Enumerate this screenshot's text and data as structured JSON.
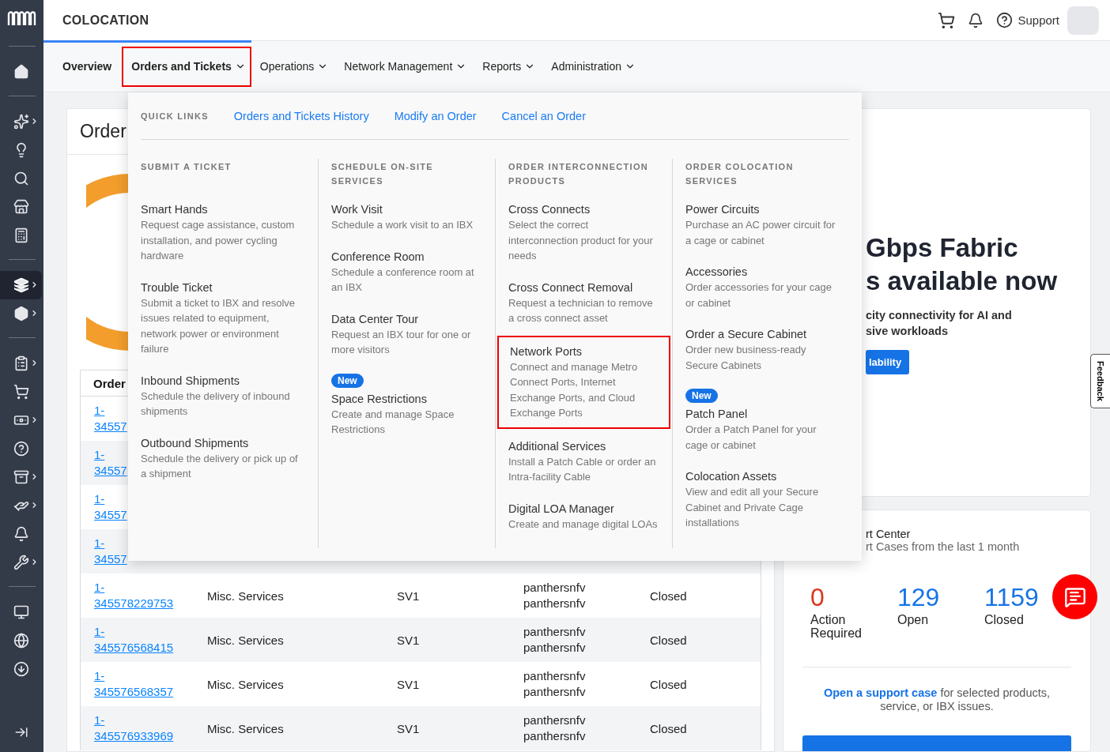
{
  "header": {
    "title": "COLOCATION",
    "support_label": "Support"
  },
  "sidebar": {
    "groups": [
      [
        {
          "expandable": false,
          "selected": false
        }
      ],
      [
        {
          "expandable": true,
          "selected": false
        },
        {
          "expandable": false,
          "selected": false
        },
        {
          "expandable": false,
          "selected": false
        },
        {
          "expandable": false,
          "selected": false
        },
        {
          "expandable": false,
          "selected": false
        }
      ],
      [
        {
          "expandable": true,
          "selected": true
        },
        {
          "expandable": true,
          "selected": false
        }
      ],
      [
        {
          "expandable": true,
          "selected": false
        },
        {
          "expandable": false,
          "selected": false
        },
        {
          "expandable": true,
          "selected": false
        },
        {
          "expandable": false,
          "selected": false
        },
        {
          "expandable": true,
          "selected": false
        },
        {
          "expandable": true,
          "selected": false
        },
        {
          "expandable": false,
          "selected": false
        },
        {
          "expandable": true,
          "selected": false
        }
      ],
      [
        {
          "expandable": false,
          "selected": false
        },
        {
          "expandable": false,
          "selected": false
        },
        {
          "expandable": false,
          "selected": false
        }
      ]
    ]
  },
  "nav": {
    "tabs": [
      {
        "label": "Overview",
        "selected": false,
        "emphasized": true,
        "has_menu": false
      },
      {
        "label": "Orders and Tickets",
        "selected": true,
        "emphasized": true,
        "has_menu": true
      },
      {
        "label": "Operations",
        "selected": false,
        "emphasized": false,
        "has_menu": true
      },
      {
        "label": "Network Management",
        "selected": false,
        "emphasized": false,
        "has_menu": true
      },
      {
        "label": "Reports",
        "selected": false,
        "emphasized": false,
        "has_menu": true
      },
      {
        "label": "Administration",
        "selected": false,
        "emphasized": false,
        "has_menu": true
      }
    ]
  },
  "menu": {
    "quick_links_heading": "QUICK LINKS",
    "quick_links": [
      "Orders and Tickets History",
      "Modify an Order",
      "Cancel an Order"
    ],
    "columns": [
      {
        "heading": "SUBMIT A TICKET",
        "items": [
          {
            "title": "Smart Hands",
            "description": "Request cage assistance, custom installation, and power cycling hardware",
            "highlighted": false
          },
          {
            "title": "Trouble Ticket",
            "description": "Submit a ticket to IBX and resolve issues related to equipment, network power or environment failure",
            "highlighted": false
          },
          {
            "title": "Inbound Shipments",
            "description": "Schedule the delivery of inbound shipments",
            "highlighted": false
          },
          {
            "title": "Outbound Shipments",
            "description": "Schedule the delivery or pick up of a shipment",
            "highlighted": false
          }
        ]
      },
      {
        "heading": "SCHEDULE ON-SITE SERVICES",
        "items": [
          {
            "title": "Work Visit",
            "description": "Schedule a work visit to an IBX",
            "highlighted": false
          },
          {
            "title": "Conference Room",
            "description": "Schedule a conference room at an IBX",
            "highlighted": false
          },
          {
            "title": "Data Center Tour",
            "description": "Request an IBX tour for one or more visitors",
            "highlighted": false
          },
          {
            "title": "Space Restrictions",
            "description": "Create and manage Space Restrictions",
            "badge": "New",
            "highlighted": false
          }
        ]
      },
      {
        "heading": "ORDER INTERCONNECTION PRODUCTS",
        "items": [
          {
            "title": "Cross Connects",
            "description": "Select the correct interconnection product for your needs",
            "highlighted": false
          },
          {
            "title": "Cross Connect Removal",
            "description": "Request a technician to remove a cross connect asset",
            "highlighted": false
          },
          {
            "title": "Network Ports",
            "description": "Connect and manage Metro Connect Ports, Internet Exchange Ports, and Cloud Exchange Ports",
            "highlighted": true
          },
          {
            "title": "Additional Services",
            "description": "Install a Patch Cable or order an Intra-facility Cable",
            "highlighted": false
          },
          {
            "title": "Digital LOA Manager",
            "description": "Create and manage digital LOAs",
            "highlighted": false
          }
        ]
      },
      {
        "heading": "ORDER COLOCATION SERVICES",
        "items": [
          {
            "title": "Power Circuits",
            "description": "Purchase an AC power circuit for a cage or cabinet",
            "highlighted": false
          },
          {
            "title": "Accessories",
            "description": "Order accessories for your cage or cabinet",
            "highlighted": false
          },
          {
            "title": "Order a Secure Cabinet",
            "description": "Order new business-ready Secure Cabinets",
            "highlighted": false
          },
          {
            "title": "Patch Panel",
            "description": "Order a Patch Panel for your cage or cabinet",
            "badge": "New",
            "highlighted": false
          },
          {
            "title": "Colocation Assets",
            "description": "View and edit all your Secure Cabinet and Private Cage installations",
            "highlighted": false
          }
        ]
      }
    ]
  },
  "orders": {
    "title": "Order",
    "column_1": "Order",
    "rows": [
      {
        "order": "1-34557"
      },
      {
        "order": "1-34557"
      },
      {
        "order": "1-34557"
      },
      {
        "order": "1-34557"
      },
      {
        "order": "1-345578229753",
        "service": "Misc. Services",
        "ibx": "SV1",
        "users": [
          "panthersnfv",
          "panthersnfv"
        ],
        "status": "Closed"
      },
      {
        "order": "1-345576568415",
        "service": "Misc. Services",
        "ibx": "SV1",
        "users": [
          "panthersnfv",
          "panthersnfv"
        ],
        "status": "Closed"
      },
      {
        "order": "1-345576568357",
        "service": "Misc. Services",
        "ibx": "SV1",
        "users": [
          "panthersnfv",
          "panthersnfv"
        ],
        "status": "Closed"
      },
      {
        "order": "1-345576933969",
        "service": "Misc. Services",
        "ibx": "SV1",
        "users": [
          "panthersnfv",
          "panthersnfv"
        ],
        "status": "Closed"
      }
    ]
  },
  "promo": {
    "headline": [
      "Gbps Fabric",
      "s available now"
    ],
    "text": [
      "city connectivity for AI and",
      "sive workloads"
    ],
    "button": "lability"
  },
  "support": {
    "title": "rt Center",
    "subtitle": "rt Cases from the last 1 month",
    "stats": [
      {
        "value": "0",
        "label": "Action Required",
        "kind": "alert"
      },
      {
        "value": "129",
        "label": "Open",
        "kind": "count"
      },
      {
        "value": "1159",
        "label": "Closed",
        "kind": "count"
      }
    ],
    "link": "Open a support case",
    "note": "for selected products, service, or IBX issues."
  },
  "feedback": "Feedback"
}
